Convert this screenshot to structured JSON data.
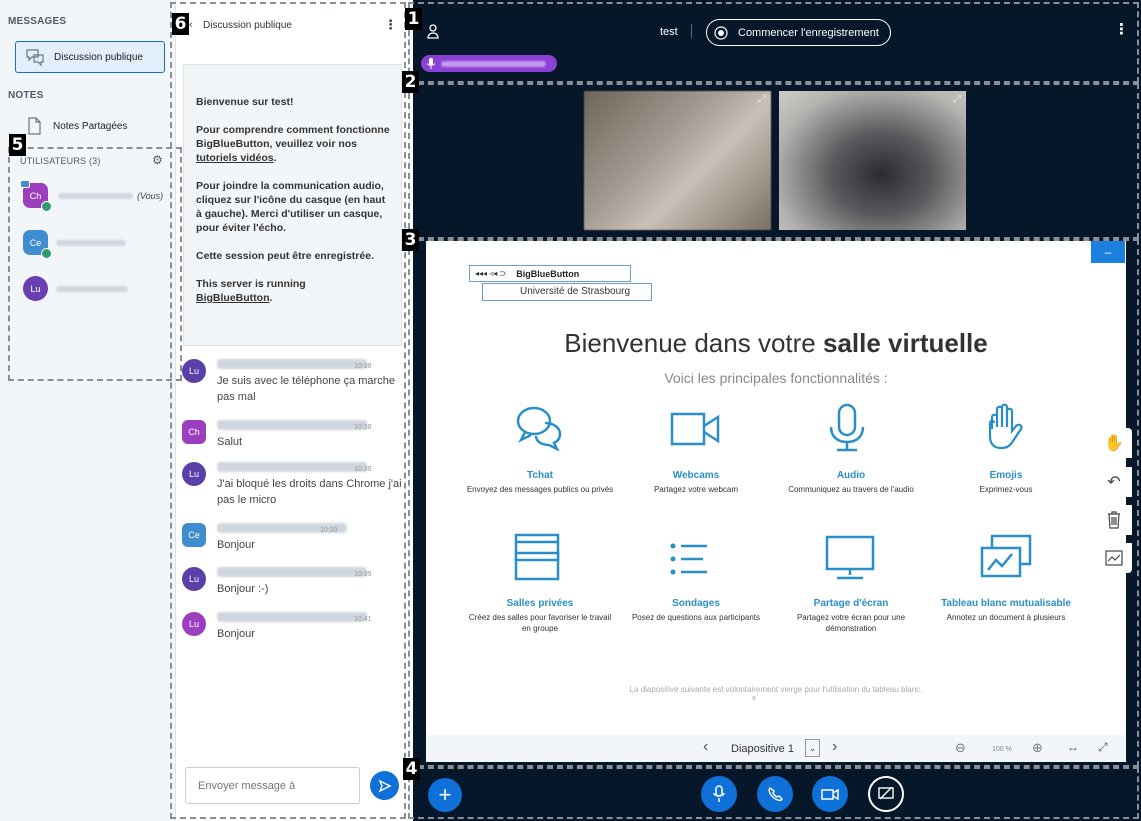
{
  "sidebar": {
    "messages_title": "MESSAGES",
    "public_chat_label": "Discussion publique",
    "notes_title": "NOTES",
    "shared_notes_label": "Notes Partagées",
    "users_title": "UTILISATEURS (3)",
    "users": [
      {
        "initials": "Ch",
        "suffix": "(Vous)",
        "color": "#9c3fbf"
      },
      {
        "initials": "Ce",
        "suffix": "",
        "color": "#3f8ccf"
      },
      {
        "initials": "Lu",
        "suffix": "",
        "color": "#6a3fb0"
      }
    ]
  },
  "chat": {
    "title": "Discussion publique",
    "welcome": {
      "line1": "Bienvenue sur test!",
      "line2a": "Pour comprendre comment fonctionne BigBlueButton, veuillez voir nos ",
      "line2_link": "tutoriels vidéos",
      "line2b": ".",
      "line3a": "Pour joindre la communication audio, cliquez sur l'icône du casque (en haut à gauche). ",
      "line3b": "Merci d'utiliser un casque, pour éviter l'écho.",
      "line4": "Cette session peut être enregistrée.",
      "line5": "This server is running",
      "line5_link": "BigBlueButton",
      "line5_end": "."
    },
    "messages": [
      {
        "initials": "Lu",
        "time": "10:38",
        "text": "Je suis avec le téléphone ça marche pas mal",
        "color": "#5a3fa8",
        "shape": "round"
      },
      {
        "initials": "Ch",
        "time": "10:38",
        "text": "Salut",
        "color": "#9c3fbf",
        "shape": "square"
      },
      {
        "initials": "Lu",
        "time": "10:39",
        "text": "J'ai bloqué les droits dans Chrome j'ai pas le micro",
        "color": "#5a3fa8",
        "shape": "round"
      },
      {
        "initials": "Ce",
        "time": "10:39",
        "text": "Bonjour",
        "color": "#3f8ccf",
        "shape": "square"
      },
      {
        "initials": "Lu",
        "time": "10:39",
        "text": "Bonjour :-)",
        "color": "#5a3fa8",
        "shape": "round"
      },
      {
        "initials": "Lu",
        "time": "10:41",
        "text": "Bonjour",
        "color": "#9c3fbf",
        "shape": "round"
      }
    ],
    "input_placeholder": "Envoyer message à"
  },
  "header": {
    "meeting_name": "test",
    "record_label": "Commencer l'enregistrement"
  },
  "slide": {
    "logo_text": "BigBlueButton",
    "logo_sub": "Université de Strasbourg",
    "title_normal": "Bienvenue dans votre ",
    "title_bold": "salle virtuelle",
    "subtitle": "Voici les principales fonctionnalités :",
    "features": [
      {
        "title": "Tchat",
        "desc": "Envoyez des messages publics ou privés",
        "icon": "chat-bubbles-icon"
      },
      {
        "title": "Webcams",
        "desc": "Partagez votre webcam",
        "icon": "camera-icon"
      },
      {
        "title": "Audio",
        "desc": "Communiquez au travers de l'audio",
        "icon": "microphone-icon"
      },
      {
        "title": "Emojis",
        "desc": "Exprimez-vous",
        "icon": "hand-icon"
      },
      {
        "title": "Salles privées",
        "desc": "Créez des salles pour favoriser le travail en groupe",
        "icon": "windows-icon"
      },
      {
        "title": "Sondages",
        "desc": "Posez de questions aux participants",
        "icon": "list-icon"
      },
      {
        "title": "Partage d'écran",
        "desc": "Partagez votre écran pour une démonstration",
        "icon": "monitor-icon"
      },
      {
        "title": "Tableau blanc mutualisable",
        "desc": "Annotez un document à plusieurs",
        "icon": "whiteboard-icon"
      }
    ],
    "footer_note": "La diapositive suivante est volontairement vierge pour l'utilisation du tableau blanc.",
    "slide_label": "Diapositive 1",
    "zoom": "100 %"
  },
  "annotations": [
    "1",
    "2",
    "3",
    "4",
    "5",
    "6"
  ],
  "colors": {
    "accent": "#0f70d7",
    "dark_bg": "#06172a",
    "feature_blue": "#2a8fc9"
  }
}
